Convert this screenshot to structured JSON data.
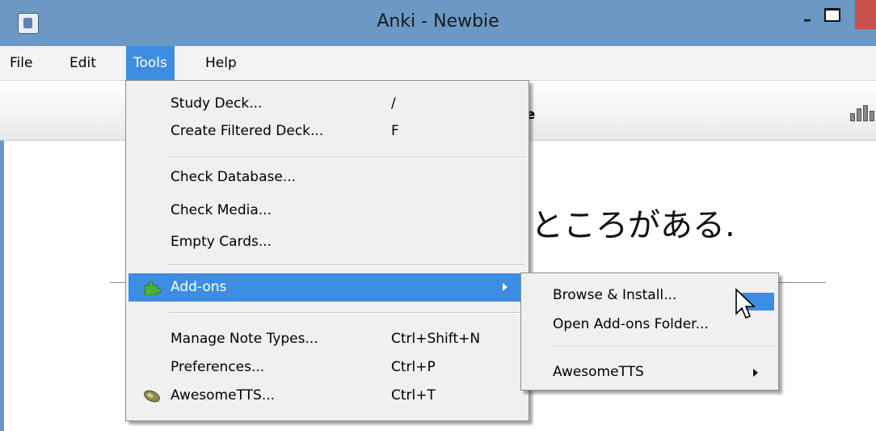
{
  "window": {
    "title": "Anki - Newbie"
  },
  "menubar": {
    "items": [
      "File",
      "Edit",
      "Tools",
      "Help"
    ]
  },
  "toolbar": {
    "browse_label": "wse"
  },
  "content": {
    "japanese_text": "ところがある."
  },
  "tools_menu": {
    "items": [
      {
        "label": "Study Deck...",
        "shortcut": "/"
      },
      {
        "label": "Create Filtered Deck...",
        "shortcut": "F"
      },
      {
        "label": "Check Database...",
        "shortcut": ""
      },
      {
        "label": "Check Media...",
        "shortcut": ""
      },
      {
        "label": "Empty Cards...",
        "shortcut": ""
      },
      {
        "label": "Add-ons",
        "shortcut": "",
        "icon": "puzzle-icon",
        "submenu": true
      },
      {
        "label": "Manage Note Types...",
        "shortcut": "Ctrl+Shift+N"
      },
      {
        "label": "Preferences...",
        "shortcut": "Ctrl+P"
      },
      {
        "label": "AwesomeTTS...",
        "shortcut": "Ctrl+T",
        "icon": "speaker-icon"
      }
    ]
  },
  "addons_submenu": {
    "items": [
      {
        "label": "Browse & Install..."
      },
      {
        "label": "Open Add-ons Folder..."
      },
      {
        "label": "AwesomeTTS",
        "submenu": true
      }
    ]
  },
  "colors": {
    "titlebar": "#6b98c4",
    "highlight": "#3d8ee2",
    "close_button": "#c7504b"
  }
}
